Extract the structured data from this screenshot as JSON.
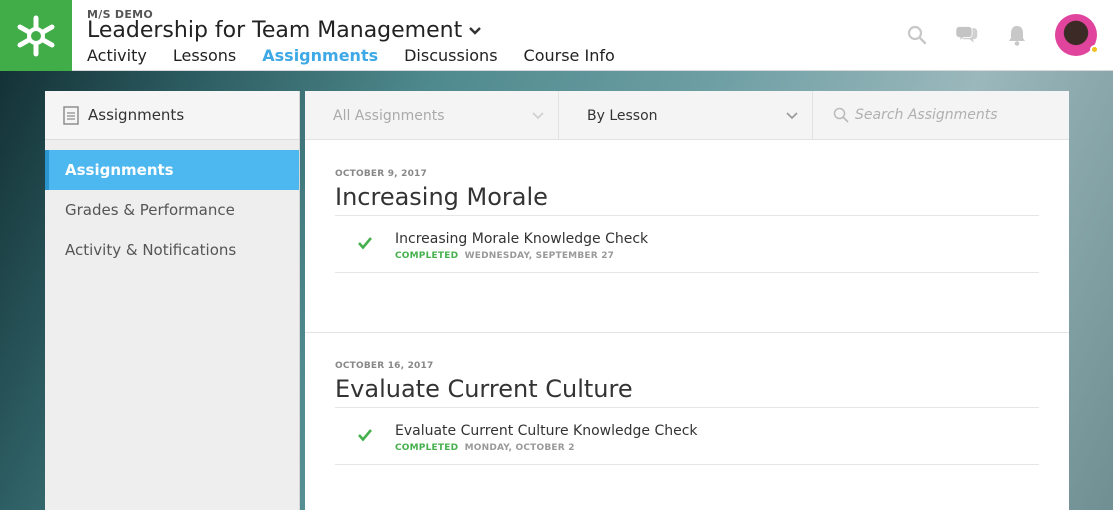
{
  "header": {
    "org": "M/S DEMO",
    "course_title": "Leadership for Team Management",
    "nav": [
      {
        "label": "Activity",
        "active": false
      },
      {
        "label": "Lessons",
        "active": false
      },
      {
        "label": "Assignments",
        "active": true
      },
      {
        "label": "Discussions",
        "active": false
      },
      {
        "label": "Course Info",
        "active": false
      }
    ],
    "icons": [
      "search-icon",
      "chat-icon",
      "bell-icon"
    ]
  },
  "sidebar": {
    "title": "Assignments",
    "items": [
      {
        "label": "Assignments",
        "active": true
      },
      {
        "label": "Grades & Performance",
        "active": false
      },
      {
        "label": "Activity & Notifications",
        "active": false
      }
    ]
  },
  "filters": {
    "assignment_filter": "All Assignments",
    "group_by": "By Lesson",
    "search_placeholder": "Search Assignments"
  },
  "lessons": [
    {
      "date": "OCTOBER 9, 2017",
      "title": "Increasing Morale",
      "assignments": [
        {
          "name": "Increasing Morale Knowledge Check",
          "status": "COMPLETED",
          "when": "WEDNESDAY, SEPTEMBER 27"
        }
      ]
    },
    {
      "date": "OCTOBER 16, 2017",
      "title": "Evaluate Current Culture",
      "assignments": [
        {
          "name": "Evaluate Current Culture Knowledge Check",
          "status": "COMPLETED",
          "when": "MONDAY, OCTOBER 2"
        }
      ]
    }
  ],
  "colors": {
    "brand_green": "#41ad49",
    "accent_blue": "#3ea9e6",
    "sidebar_active": "#4db7ef",
    "completed_green": "#45b04d",
    "presence_yellow": "#f2c01e"
  }
}
